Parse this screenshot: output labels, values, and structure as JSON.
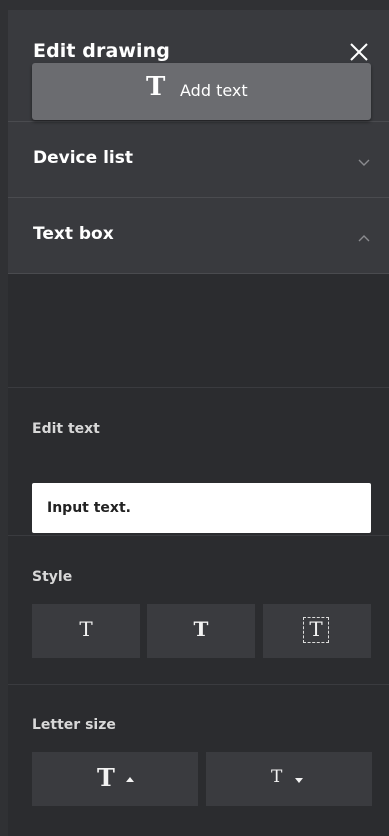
{
  "header": {
    "title": "Edit drawing",
    "close_icon": "close-icon"
  },
  "accordion": [
    {
      "label": "Device list",
      "expanded": false,
      "icon": "chevron-down-icon"
    },
    {
      "label": "Text box",
      "expanded": true,
      "icon": "chevron-up-icon"
    }
  ],
  "text_box": {
    "add_text": {
      "glyph": "T",
      "label": "Add text"
    },
    "edit_text": {
      "label": "Edit text",
      "value": "Input text."
    },
    "style": {
      "label": "Style",
      "options": [
        {
          "name": "regular",
          "glyph": "T"
        },
        {
          "name": "bold",
          "glyph": "T"
        },
        {
          "name": "outlined-box",
          "glyph": "T"
        }
      ]
    },
    "letter_size": {
      "label": "Letter size",
      "options": [
        {
          "name": "increase",
          "glyph": "T",
          "icon": "caret-up-icon"
        },
        {
          "name": "decrease",
          "glyph": "T",
          "icon": "caret-down-icon"
        }
      ]
    }
  },
  "colors": {
    "background": "#2b2c2f",
    "row": "#393a3e",
    "button": "#6b6c70",
    "tile": "#3a3b3f",
    "input_bg": "#ffffff"
  }
}
